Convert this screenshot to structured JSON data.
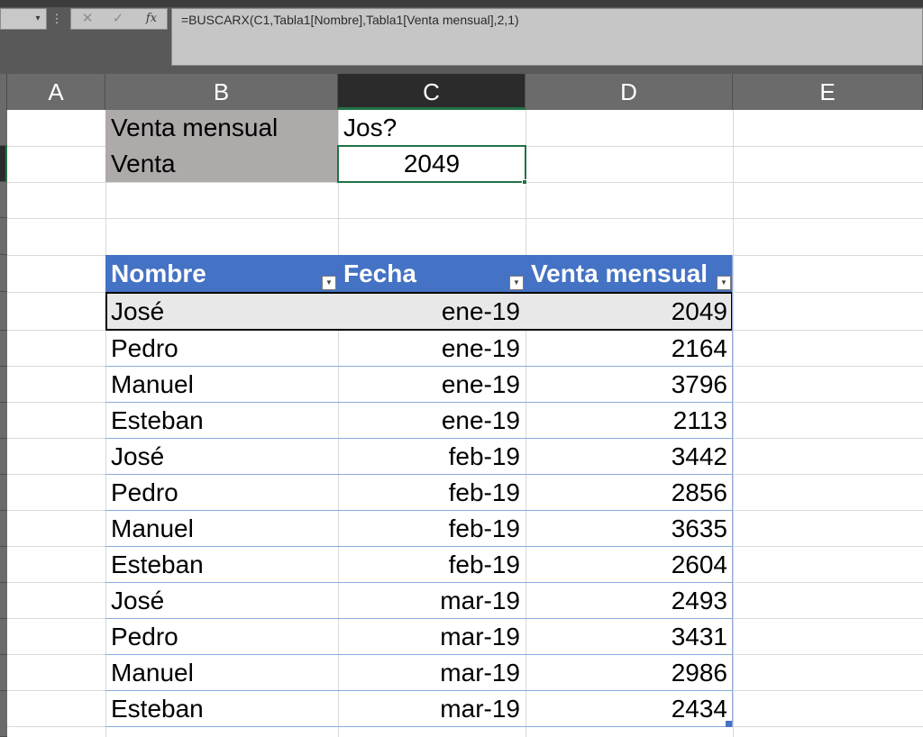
{
  "formula_bar": {
    "namebox_arrow": "▾",
    "menu_dots": "⋮",
    "cancel_icon": "✕",
    "enter_icon": "✓",
    "fx_label": "fx",
    "formula": "=BUSCARX(C1,Tabla1[Nombre],Tabla1[Venta mensual],2,1)"
  },
  "columns": [
    "A",
    "B",
    "C",
    "D",
    "E"
  ],
  "selected_column": "C",
  "lookup": {
    "label1": "Venta mensual",
    "value1": "Jos?",
    "label2": "Venta",
    "value2": "2049"
  },
  "table": {
    "name": "Tabla1",
    "headers": [
      "Nombre",
      "Fecha",
      "Venta mensual"
    ],
    "filter_icon": "▼",
    "rows": [
      {
        "nombre": "José",
        "fecha": "ene-19",
        "venta": "2049"
      },
      {
        "nombre": "Pedro",
        "fecha": "ene-19",
        "venta": "2164"
      },
      {
        "nombre": "Manuel",
        "fecha": "ene-19",
        "venta": "3796"
      },
      {
        "nombre": "Esteban",
        "fecha": "ene-19",
        "venta": "2113"
      },
      {
        "nombre": "José",
        "fecha": "feb-19",
        "venta": "3442"
      },
      {
        "nombre": "Pedro",
        "fecha": "feb-19",
        "venta": "2856"
      },
      {
        "nombre": "Manuel",
        "fecha": "feb-19",
        "venta": "3635"
      },
      {
        "nombre": "Esteban",
        "fecha": "feb-19",
        "venta": "2604"
      },
      {
        "nombre": "José",
        "fecha": "mar-19",
        "venta": "2493"
      },
      {
        "nombre": "Pedro",
        "fecha": "mar-19",
        "venta": "3431"
      },
      {
        "nombre": "Manuel",
        "fecha": "mar-19",
        "venta": "2986"
      },
      {
        "nombre": "Esteban",
        "fecha": "mar-19",
        "venta": "2434"
      }
    ]
  },
  "colors": {
    "table_header": "#4472c4",
    "accent_green": "#217346",
    "lookup_shade": "#aeaaaa"
  }
}
